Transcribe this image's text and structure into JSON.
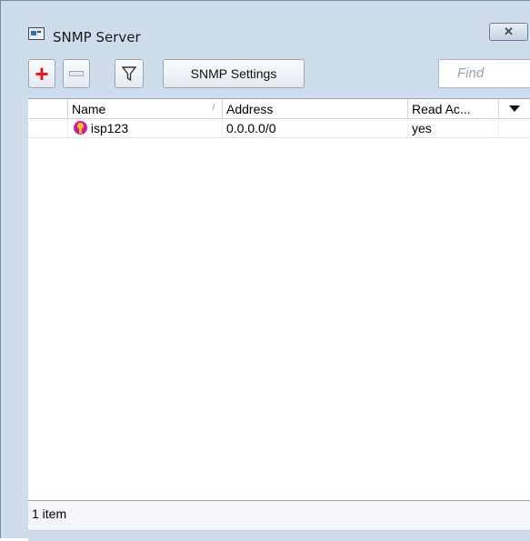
{
  "window": {
    "title": "SNMP Server",
    "close_icon": "close-icon"
  },
  "toolbar": {
    "add_icon": "plus-icon",
    "remove_icon": "minus-icon",
    "filter_icon": "filter-icon",
    "settings_label": "SNMP Settings",
    "find_placeholder": "Find"
  },
  "table": {
    "columns": [
      "Name",
      "Address",
      "Read Ac..."
    ],
    "rows": [
      {
        "name": "isp123",
        "address": "0.0.0.0/0",
        "read_access": "yes",
        "icon": "community-icon"
      }
    ]
  },
  "status": {
    "text": "1 item"
  },
  "colors": {
    "add": "#e3121b",
    "window_bg": "#cfdcec"
  }
}
